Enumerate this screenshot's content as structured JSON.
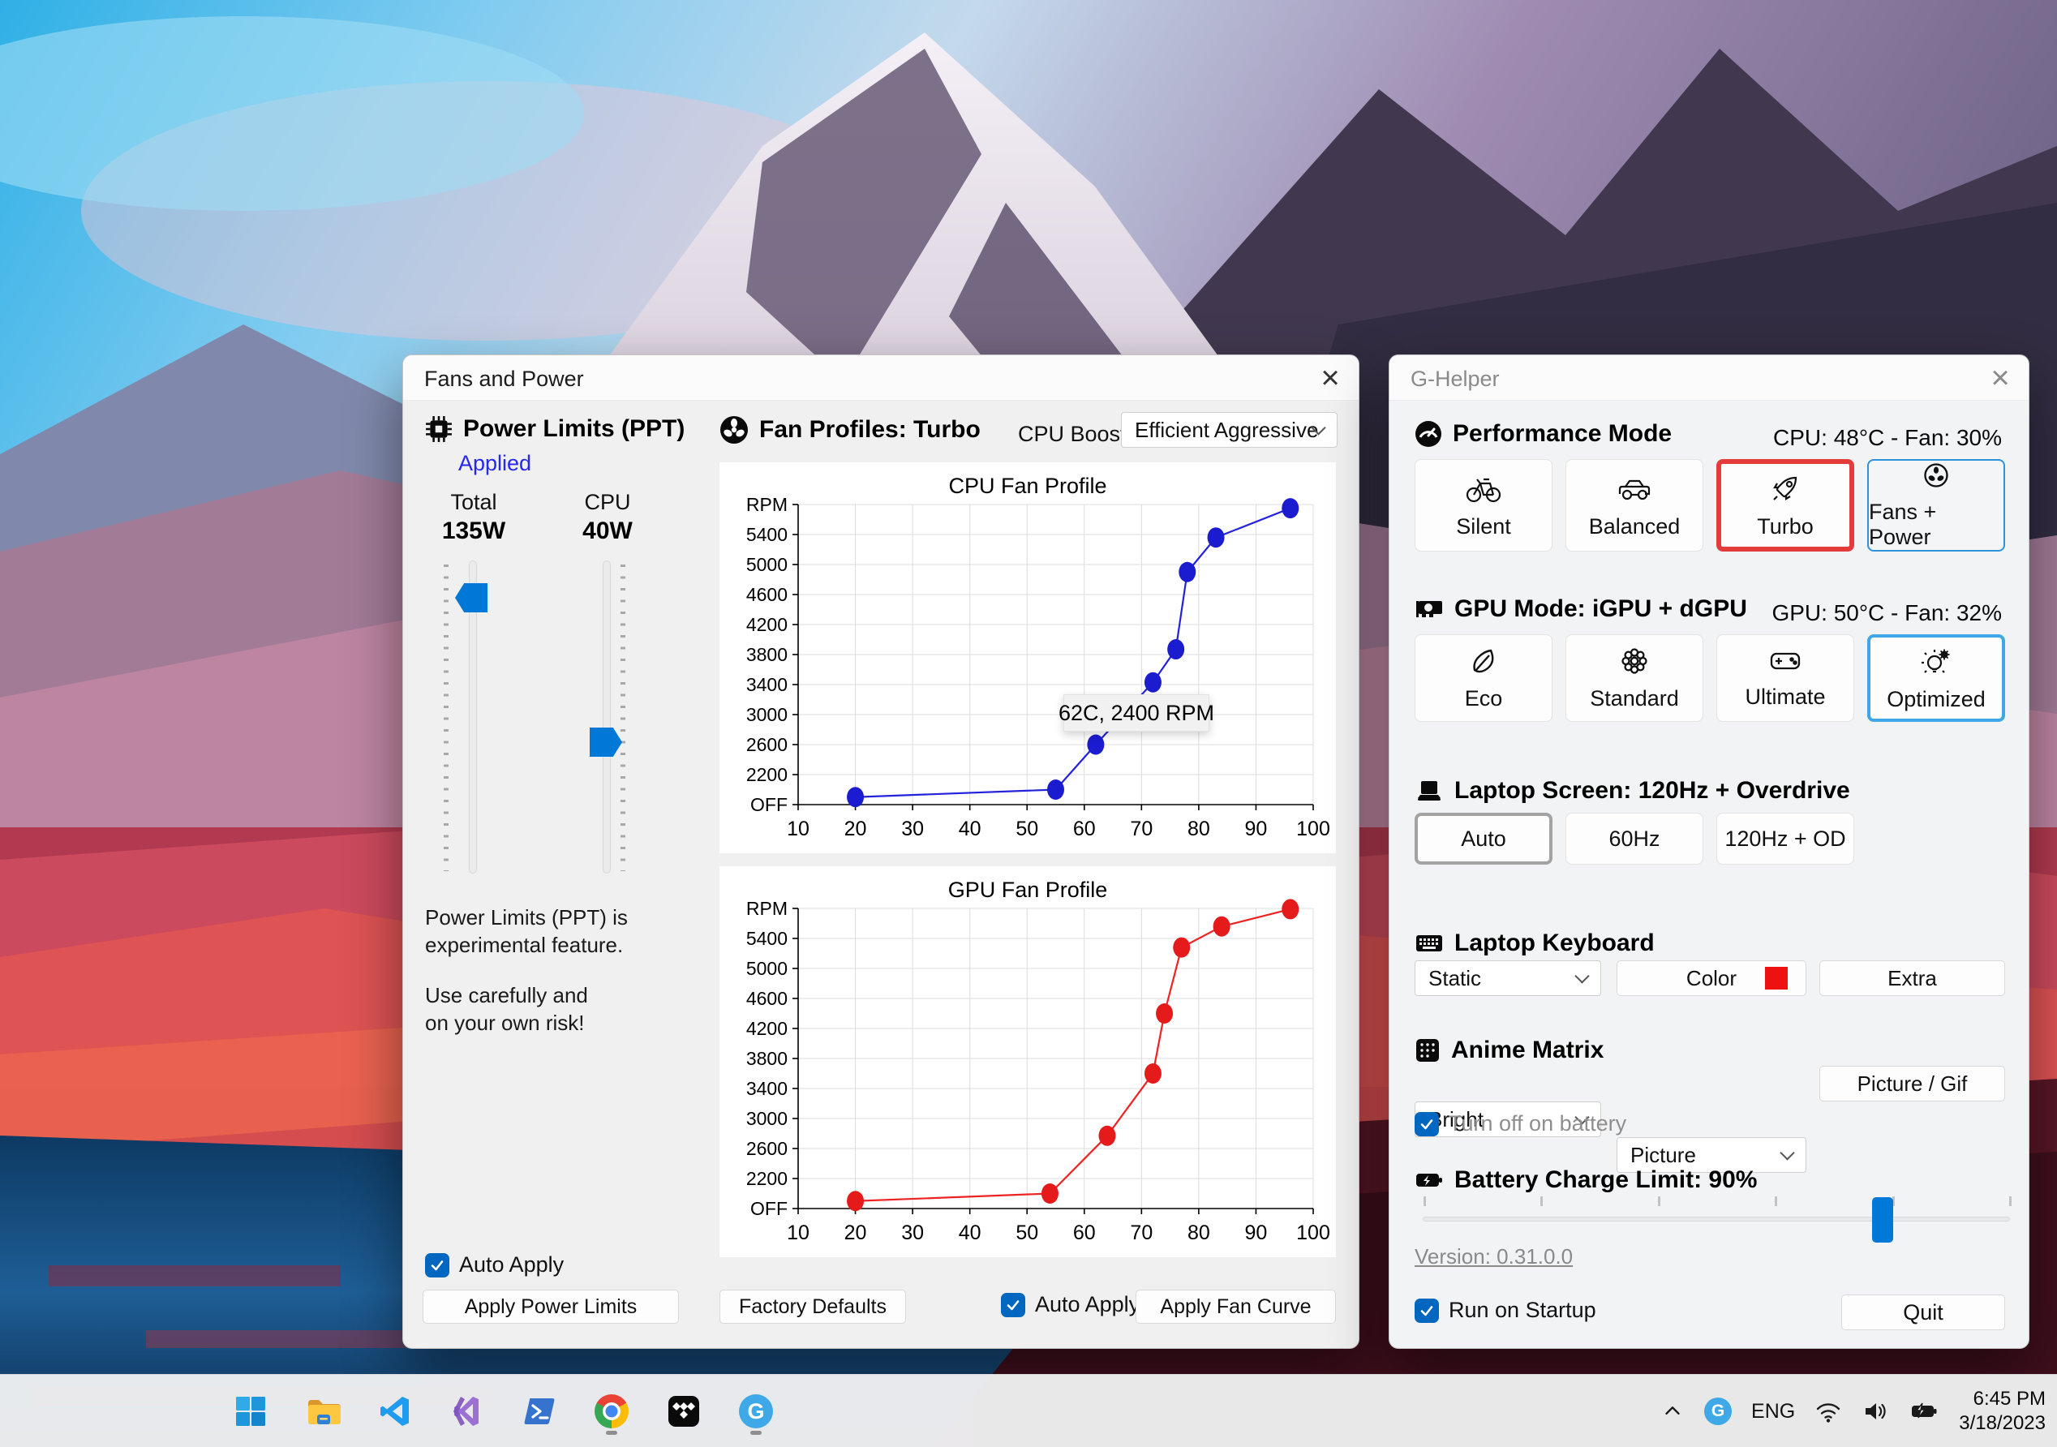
{
  "icons": {
    "close": "×"
  },
  "colors": {
    "accent_blue": "#0078d7",
    "selected_red_border": "#e43b3b",
    "selected_blue_border": "#41a6e8",
    "link_blue": "#2727ee",
    "cpu_line": "#2222dd",
    "gpu_line": "#ee2222",
    "keyboard_swatch": "#ee1111"
  },
  "fans_window": {
    "title": "Fans and Power",
    "power": {
      "heading": "Power Limits (PPT)",
      "applied": "Applied",
      "total_label": "Total",
      "total_value": "135W",
      "cpu_label": "CPU",
      "cpu_value": "40W",
      "note_line1": "Power Limits (PPT) is",
      "note_line2": "experimental feature.",
      "note_line3": "Use carefully and",
      "note_line4": "on your own risk!",
      "auto_apply": "Auto Apply",
      "apply_button": "Apply Power Limits"
    },
    "profiles": {
      "heading": "Fan Profiles: Turbo",
      "cpu_boost_label": "CPU Boost",
      "cpu_boost_value": "Efficient Aggressive",
      "factory_defaults": "Factory Defaults",
      "auto_apply": "Auto Apply",
      "apply_button": "Apply Fan Curve"
    }
  },
  "chart_data": [
    {
      "type": "line",
      "title": "CPU Fan Profile",
      "xlabel": "",
      "ylabel": "RPM",
      "grid": true,
      "x_range": [
        10,
        100
      ],
      "y_range": [
        1800,
        5800
      ],
      "x_ticks": [
        10,
        20,
        30,
        40,
        50,
        60,
        70,
        80,
        90,
        100
      ],
      "y_ticks": [
        {
          "label": "OFF",
          "value": 1800
        },
        {
          "label": "2200",
          "value": 2200
        },
        {
          "label": "2600",
          "value": 2600
        },
        {
          "label": "3000",
          "value": 3000
        },
        {
          "label": "3400",
          "value": 3400
        },
        {
          "label": "3800",
          "value": 3800
        },
        {
          "label": "4200",
          "value": 4200
        },
        {
          "label": "4600",
          "value": 4600
        },
        {
          "label": "5000",
          "value": 5000
        },
        {
          "label": "5400",
          "value": 5400
        },
        {
          "label": "RPM",
          "value": 5800
        }
      ],
      "series": [
        {
          "name": "CPU fan curve",
          "color": "#2222dd",
          "marker_color": "#1b1bd0",
          "points": [
            [
              20,
              1900
            ],
            [
              55,
              2000
            ],
            [
              62,
              2600
            ],
            [
              72,
              3430
            ],
            [
              76,
              3870
            ],
            [
              78,
              4900
            ],
            [
              83,
              5360
            ],
            [
              96,
              5750
            ]
          ]
        }
      ],
      "annotation": "62C, 2400 RPM"
    },
    {
      "type": "line",
      "title": "GPU Fan Profile",
      "xlabel": "",
      "ylabel": "RPM",
      "grid": true,
      "x_range": [
        10,
        100
      ],
      "y_range": [
        1800,
        5800
      ],
      "x_ticks": [
        10,
        20,
        30,
        40,
        50,
        60,
        70,
        80,
        90,
        100
      ],
      "y_ticks": [
        {
          "label": "OFF",
          "value": 1800
        },
        {
          "label": "2200",
          "value": 2200
        },
        {
          "label": "2600",
          "value": 2600
        },
        {
          "label": "3000",
          "value": 3000
        },
        {
          "label": "3400",
          "value": 3400
        },
        {
          "label": "3800",
          "value": 3800
        },
        {
          "label": "4200",
          "value": 4200
        },
        {
          "label": "4600",
          "value": 4600
        },
        {
          "label": "5000",
          "value": 5000
        },
        {
          "label": "5400",
          "value": 5400
        },
        {
          "label": "RPM",
          "value": 5800
        }
      ],
      "series": [
        {
          "name": "GPU fan curve",
          "color": "#ee2222",
          "marker_color": "#e51b1b",
          "points": [
            [
              20,
              1900
            ],
            [
              54,
              2000
            ],
            [
              64,
              2770
            ],
            [
              72,
              3600
            ],
            [
              74,
              4400
            ],
            [
              77,
              5280
            ],
            [
              84,
              5560
            ],
            [
              96,
              5790
            ]
          ]
        }
      ]
    }
  ],
  "ghelper_window": {
    "title": "G-Helper",
    "performance": {
      "heading": "Performance Mode",
      "status": "CPU: 48°C -  Fan: 30%",
      "buttons": [
        "Silent",
        "Balanced",
        "Turbo",
        "Fans + Power"
      ],
      "selected": "Turbo"
    },
    "gpu_mode": {
      "heading": "GPU Mode: iGPU + dGPU",
      "status": "GPU: 50°C -  Fan: 32%",
      "buttons": [
        "Eco",
        "Standard",
        "Ultimate",
        "Optimized"
      ],
      "selected": "Optimized"
    },
    "screen": {
      "heading": "Laptop Screen: 120Hz + Overdrive",
      "buttons": [
        "Auto",
        "60Hz",
        "120Hz + OD"
      ],
      "selected": "Auto"
    },
    "keyboard": {
      "heading": "Laptop Keyboard",
      "mode": "Static",
      "color_button": "Color",
      "extra_button": "Extra"
    },
    "anime_matrix": {
      "heading": "Anime Matrix",
      "brightness": "Bright",
      "mode": "Picture",
      "button": "Picture / Gif",
      "checkbox": "Turn off on battery",
      "checkbox_checked": true
    },
    "battery": {
      "heading": "Battery Charge Limit: 90%",
      "percent": 90
    },
    "version": "Version: 0.31.0.0",
    "run_on_startup": "Run on Startup",
    "run_on_startup_checked": true,
    "quit": "Quit"
  },
  "taskbar": {
    "apps": [
      "start",
      "file-explorer",
      "vscode",
      "visual-studio",
      "powershell",
      "chrome",
      "tidal",
      "g-helper"
    ],
    "running_apps": [
      "chrome",
      "g-helper"
    ],
    "tray": {
      "language": "ENG",
      "time": "6:45 PM",
      "date": "3/18/2023"
    }
  }
}
